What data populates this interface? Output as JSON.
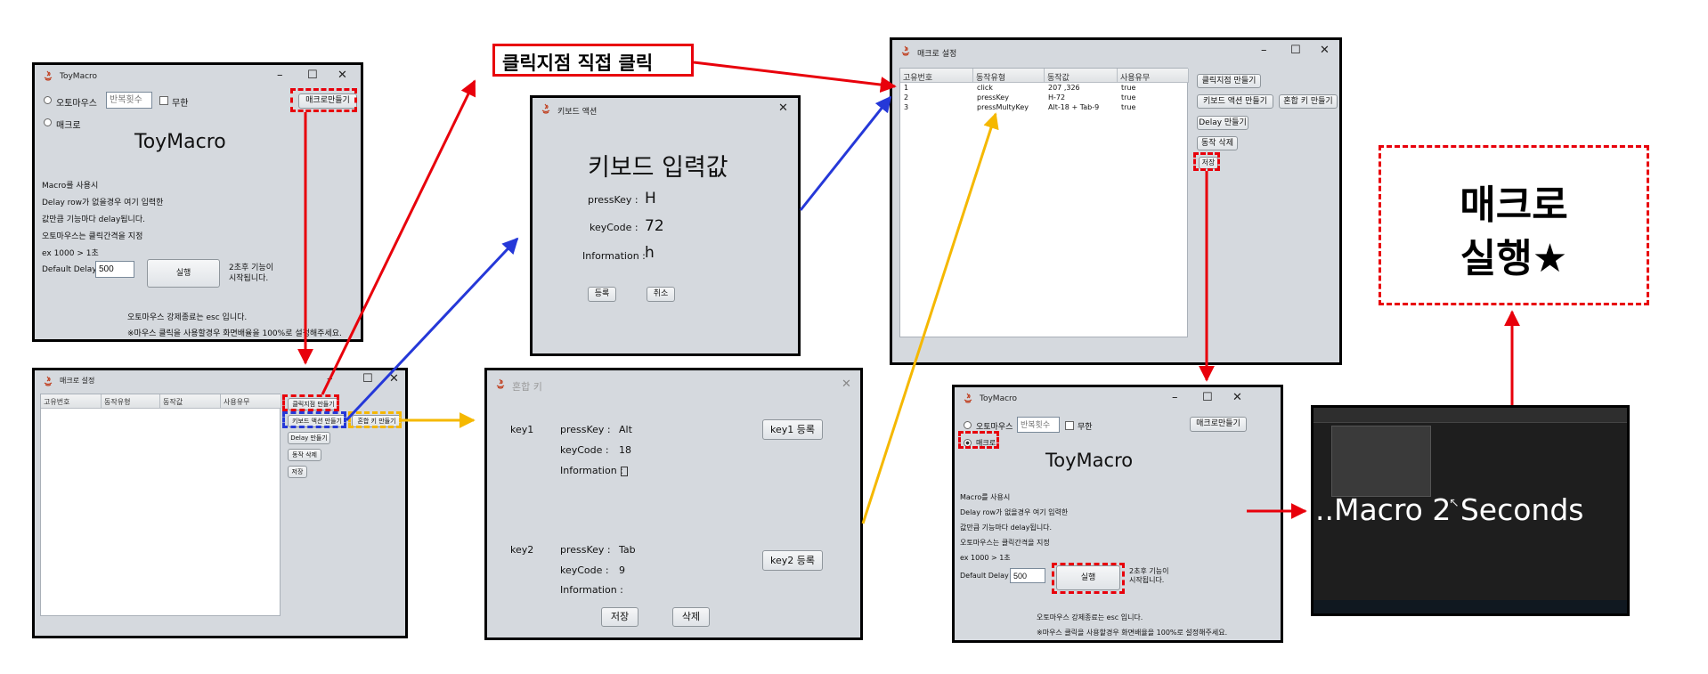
{
  "colors": {
    "red": "#e8000b",
    "blue": "#2538d8",
    "yellow": "#f5b800",
    "window_bg": "#d5d9de"
  },
  "callout": {
    "text": "클릭지점 직접 클릭"
  },
  "bigbox": {
    "line1": "매크로",
    "line2": "실행★"
  },
  "toymacro": {
    "title": "ToyMacro",
    "auto_mouse": "오토마우스",
    "repeat_placeholder": "반복횟수",
    "infinite": "무한",
    "macro": "매크로",
    "make_macro_button": "매크로만들기",
    "heading": "ToyMacro",
    "desc": [
      "Macro를 사용시",
      "Delay row가 없을경우 여기 입력한",
      "값만큼 기능마다 delay됩니다.",
      "오토마우스는 클릭간격을 지정",
      "ex 1000 > 1초"
    ],
    "delay_label": "Default Delay",
    "delay_value": "500",
    "run_button": "실행",
    "after_line1": "2초후 기능이",
    "after_line2": "시작됩니다.",
    "esc_note": "오토마우스 강제종료는 esc 입니다.",
    "zoom_note": "※마우스 클릭을 사용할경우 화면배율을 100%로 설정해주세요."
  },
  "macro_settings": {
    "title": "매크로 설정",
    "columns": [
      "고유번호",
      "동작유형",
      "동작값",
      "사용유무"
    ],
    "rows": [
      [
        "1",
        "click",
        "207 ,326",
        "true"
      ],
      [
        "2",
        "pressKey",
        "H-72",
        "true"
      ],
      [
        "3",
        "pressMultyKey",
        "Alt-18 + Tab-9",
        "true"
      ]
    ],
    "buttons": {
      "click_point": "클릭지점 만들기",
      "keyboard_action": "키보드 액션 만들기",
      "combo_key": "혼합 키 만들기",
      "delay": "Delay 만들기",
      "delete_action": "동작 삭제",
      "save": "저장"
    }
  },
  "keyboard_action": {
    "title": "키보드 액션",
    "heading": "키보드 입력값",
    "presskey_label": "pressKey :",
    "presskey_value": "H",
    "keycode_label": "keyCode :",
    "keycode_value": "72",
    "info_label": "Information :",
    "info_value": "h",
    "register": "등록",
    "cancel": "취소"
  },
  "combo_key": {
    "title": "혼합 키",
    "key1_label": "key1",
    "key1_presskey_label": "pressKey :",
    "key1_presskey_value": "Alt",
    "key1_keycode_label": "keyCode :",
    "key1_keycode_value": "18",
    "key1_info_label": "Information :",
    "key1_info_value": "",
    "key1_register": "key1 등록",
    "key2_label": "key2",
    "key2_presskey_label": "pressKey :",
    "key2_presskey_value": "Tab",
    "key2_keycode_label": "keyCode :",
    "key2_keycode_value": "9",
    "key2_info_label": "Information :",
    "key2_register": "key2 등록",
    "save": "저장",
    "delete": "삭제"
  },
  "running": {
    "text": "..Macro 2 Seconds"
  }
}
